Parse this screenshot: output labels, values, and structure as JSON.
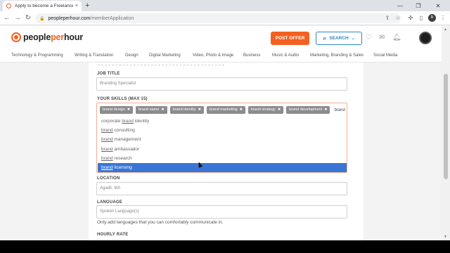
{
  "browser": {
    "tab_title": "Apply to become a Freelancer -",
    "tab_close": "×",
    "new_tab": "+",
    "url_host": "peopleperhour.com",
    "url_path": "/memberApplication",
    "profile_initial": "b"
  },
  "header": {
    "logo_people": "people",
    "logo_per": "per",
    "logo_hour": "hour",
    "post_offer": "POST OFFER",
    "search": "SEARCH"
  },
  "categories": [
    "Technology & Programming",
    "Writing & Translation",
    "Design",
    "Digital Marketing",
    "Video, Photo & Image",
    "Business",
    "Music & Audio",
    "Marketing, Branding & Sales",
    "Social Media"
  ],
  "form": {
    "job_title_label": "JOB TITLE",
    "job_title_value": "Branding Specialist",
    "skills_label": "YOUR SKILLS (MAX 15)",
    "skills_tags": [
      "brand design",
      "brand name",
      "brand identity",
      "brand marketing",
      "brand strategy",
      "brand development"
    ],
    "skills_typed": "brand",
    "suggestions": [
      {
        "prefix": "corporate ",
        "match": "brand",
        "suffix": " identity"
      },
      {
        "prefix": "",
        "match": "brand",
        "suffix": " consulting"
      },
      {
        "prefix": "",
        "match": "brand",
        "suffix": " management"
      },
      {
        "prefix": "",
        "match": "brand",
        "suffix": " ambassador"
      },
      {
        "prefix": "",
        "match": "brand",
        "suffix": " research"
      },
      {
        "prefix": "",
        "match": "brand",
        "suffix": " licensing"
      }
    ],
    "selected_suggestion_index": 5,
    "location_label": "LOCATION",
    "location_value": "Agadir, MA",
    "language_label": "LANGUAGE",
    "language_placeholder": "Spoken Language(s)",
    "language_help": "Only add languages that you can comfortably communicate in.",
    "hourly_rate_label": "HOURLY RATE"
  }
}
